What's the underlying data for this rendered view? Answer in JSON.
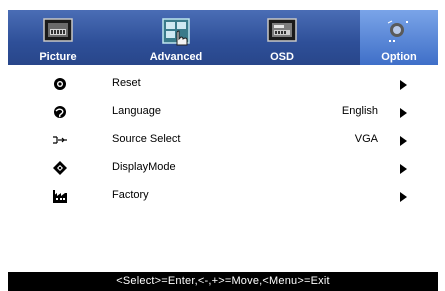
{
  "tabs": [
    {
      "label": "Picture",
      "icon": "picture-icon"
    },
    {
      "label": "Advanced",
      "icon": "advanced-icon"
    },
    {
      "label": "OSD",
      "icon": "osd-icon"
    },
    {
      "label": "Option",
      "icon": "option-icon",
      "active": true
    }
  ],
  "menu": [
    {
      "label": "Reset",
      "value": "",
      "icon": "reset-icon"
    },
    {
      "label": "Language",
      "value": "English",
      "icon": "language-icon"
    },
    {
      "label": "Source Select",
      "value": "VGA",
      "icon": "source-select-icon"
    },
    {
      "label": "DisplayMode",
      "value": "",
      "icon": "display-mode-icon"
    },
    {
      "label": "Factory",
      "value": "",
      "icon": "factory-icon"
    }
  ],
  "status": "<Select>=Enter,<-,+>=Move,<Menu>=Exit",
  "colors": {
    "tabbar": "#2e4f98",
    "active_tab": "#5b8ee0",
    "status_bg": "#000000"
  }
}
